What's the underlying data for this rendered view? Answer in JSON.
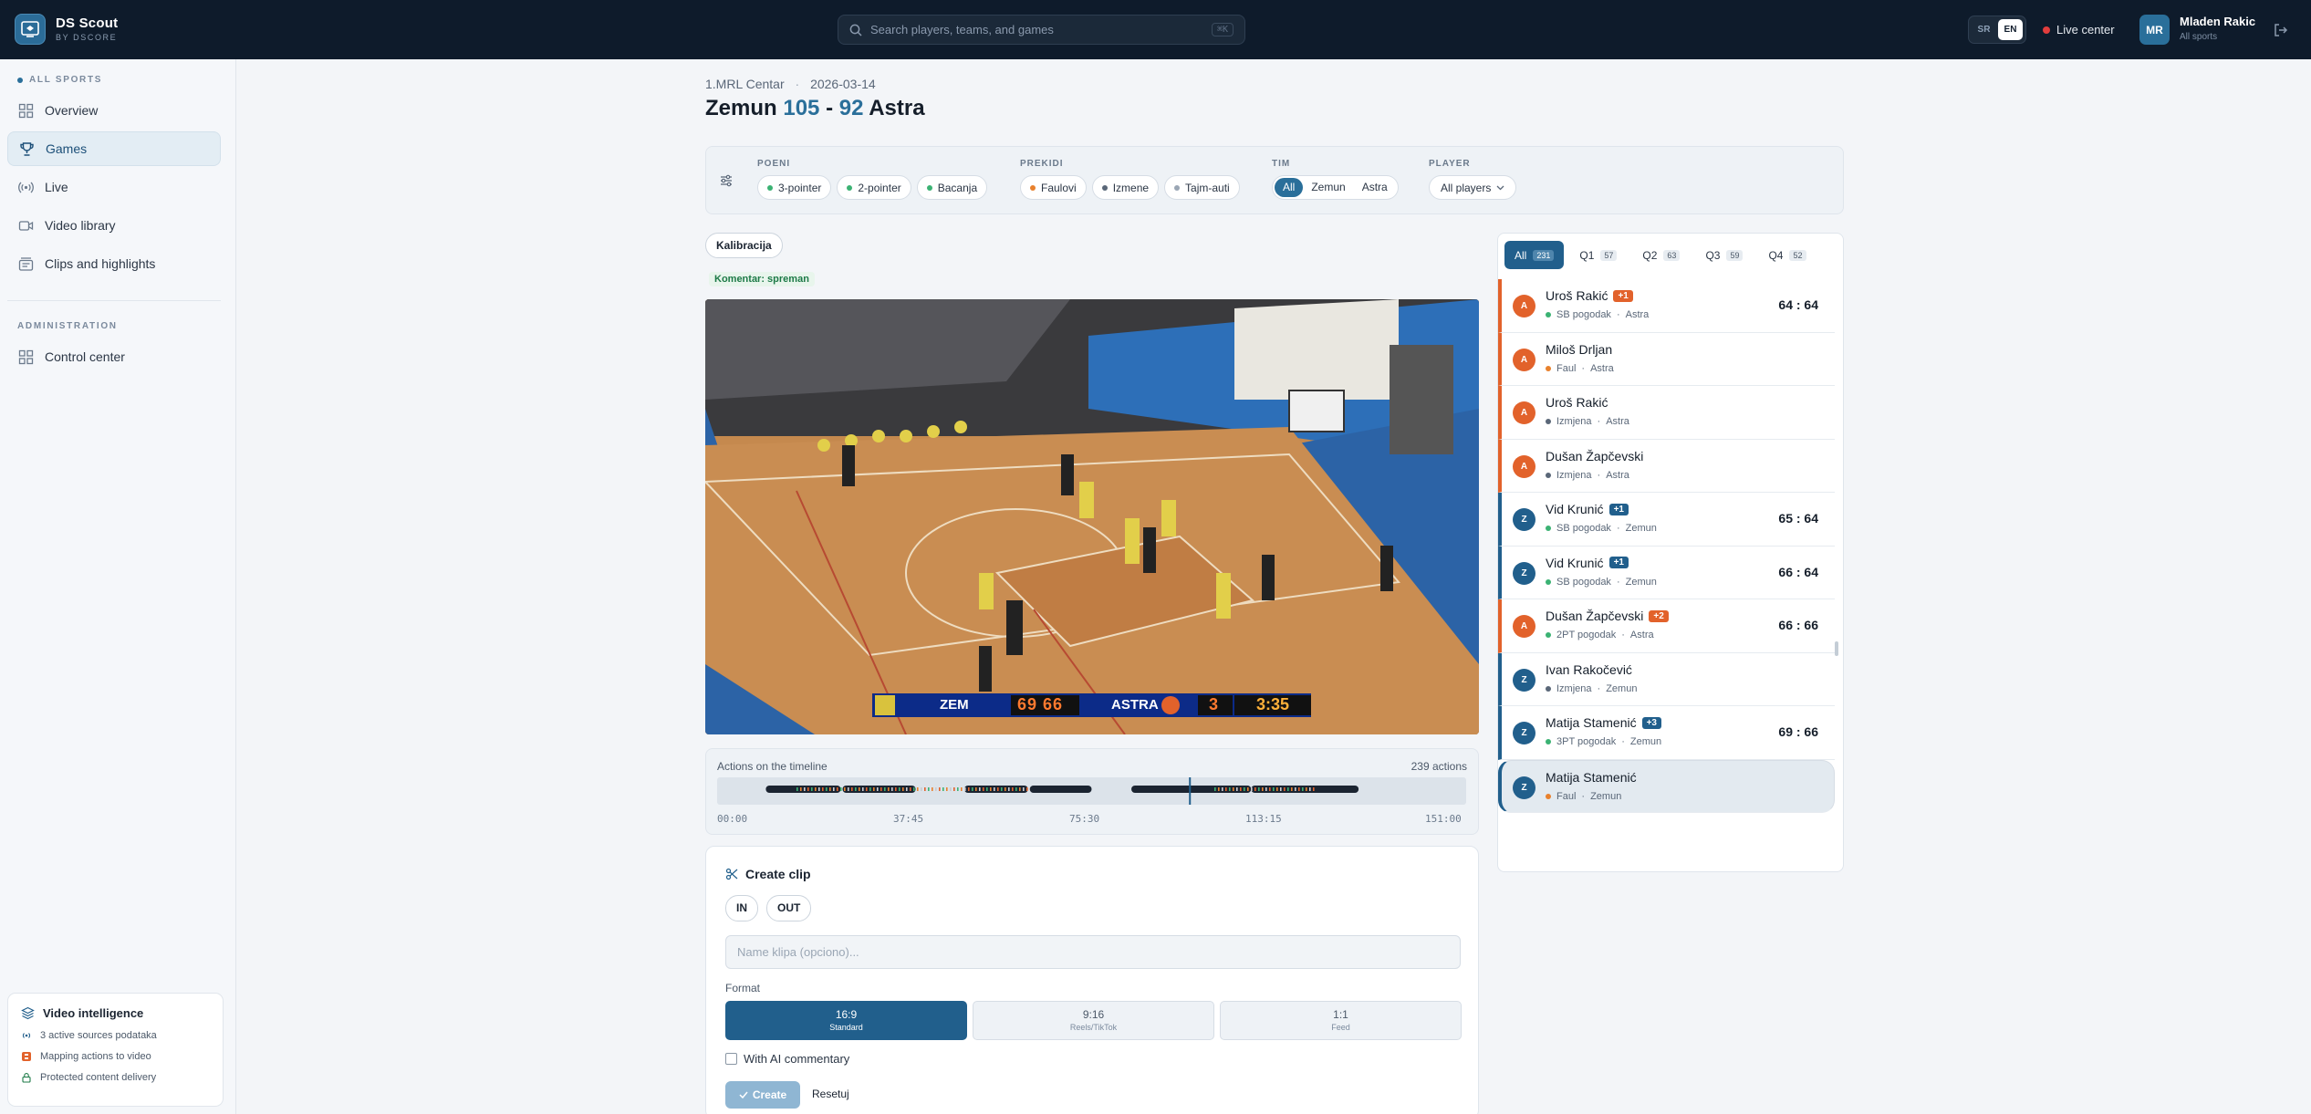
{
  "app": {
    "name": "DS Scout",
    "sub": "BY DSCORE"
  },
  "search": {
    "placeholder": "Search players, teams, and games",
    "shortcut": "⌘K"
  },
  "lang": [
    "SR",
    "EN"
  ],
  "live_center": "Live center",
  "user": {
    "initials": "MR",
    "name": "Mladen Rakic",
    "sub": "All sports"
  },
  "sidebar": {
    "section1": "ALL SPORTS",
    "items": [
      {
        "label": "Overview",
        "icon": "grid-icon"
      },
      {
        "label": "Games",
        "icon": "trophy-icon"
      },
      {
        "label": "Live",
        "icon": "broadcast-icon"
      },
      {
        "label": "Video library",
        "icon": "video-icon"
      },
      {
        "label": "Clips and highlights",
        "icon": "clips-icon"
      }
    ],
    "section2": "ADMINISTRATION",
    "admin_items": [
      {
        "label": "Control center",
        "icon": "grid-icon"
      }
    ],
    "vi": {
      "title": "Video intelligence",
      "rows": [
        "3 active sources podataka",
        "Mapping actions to video",
        "Protected content delivery"
      ]
    }
  },
  "game": {
    "league": "1.MRL Centar",
    "sep": "·",
    "date": "2026-03-14",
    "home": "Zemun",
    "home_score": "105",
    "dash": "-",
    "away_score": "92",
    "away": "Astra"
  },
  "filters": {
    "poeni": {
      "label": "POENI",
      "chips": [
        "3-pointer",
        "2-pointer",
        "Bacanja"
      ]
    },
    "prekidi": {
      "label": "PREKIDI",
      "chips": [
        "Faulovi",
        "Izmene",
        "Tajm-auti"
      ]
    },
    "tim": {
      "label": "TIM",
      "options": [
        "All",
        "Zemun",
        "Astra"
      ]
    },
    "player": {
      "label": "PLAYER",
      "value": "All players"
    }
  },
  "kalibracija": "Kalibracija",
  "komentar": "Komentar: spreman",
  "video": {
    "team1": "ZEM",
    "score": "69 66",
    "team2": "ASTRA",
    "period": "3",
    "clock": "3:35"
  },
  "timeline": {
    "title": "Actions on the timeline",
    "count": "239 actions",
    "ticks": [
      "00:00",
      "37:45",
      "75:30",
      "113:15",
      "151:00"
    ],
    "playhead": 0.63
  },
  "clip": {
    "title": "Create clip",
    "in": "IN",
    "out": "OUT",
    "name_placeholder": "Name klipa (opciono)...",
    "format_label": "Format",
    "formats": [
      {
        "ratio": "16:9",
        "name": "Standard"
      },
      {
        "ratio": "9:16",
        "name": "Reels/TikTok"
      },
      {
        "ratio": "1:1",
        "name": "Feed"
      }
    ],
    "ai": "With AI commentary",
    "create": "Create",
    "reset": "Resetuj"
  },
  "quarters": [
    {
      "label": "All",
      "count": "231"
    },
    {
      "label": "Q1",
      "count": "57"
    },
    {
      "label": "Q2",
      "count": "63"
    },
    {
      "label": "Q3",
      "count": "59"
    },
    {
      "label": "Q4",
      "count": "52"
    }
  ],
  "events": [
    {
      "team": "A",
      "name": "Uroš Rakić",
      "badge": "+1",
      "type": "SB pogodak",
      "team_name": "Astra",
      "score": "64 : 64",
      "dot": "#3bb273"
    },
    {
      "team": "A",
      "name": "Miloš Drljan",
      "badge": "",
      "type": "Faul",
      "team_name": "Astra",
      "score": "",
      "dot": "#e8812d"
    },
    {
      "team": "A",
      "name": "Uroš Rakić",
      "badge": "",
      "type": "Izmjena",
      "team_name": "Astra",
      "score": "",
      "dot": "#5a6778"
    },
    {
      "team": "A",
      "name": "Dušan Žapčevski",
      "badge": "",
      "type": "Izmjena",
      "team_name": "Astra",
      "score": "",
      "dot": "#5a6778"
    },
    {
      "team": "Z",
      "name": "Vid Krunić",
      "badge": "+1",
      "type": "SB pogodak",
      "team_name": "Zemun",
      "score": "65 : 64",
      "dot": "#3bb273"
    },
    {
      "team": "Z",
      "name": "Vid Krunić",
      "badge": "+1",
      "type": "SB pogodak",
      "team_name": "Zemun",
      "score": "66 : 64",
      "dot": "#3bb273"
    },
    {
      "team": "A",
      "name": "Dušan Žapčevski",
      "badge": "+2",
      "type": "2PT pogodak",
      "team_name": "Astra",
      "score": "66 : 66",
      "dot": "#3bb273"
    },
    {
      "team": "Z",
      "name": "Ivan Rakočević",
      "badge": "",
      "type": "Izmjena",
      "team_name": "Zemun",
      "score": "",
      "dot": "#5a6778"
    },
    {
      "team": "Z",
      "name": "Matija Stamenić",
      "badge": "+3",
      "type": "3PT pogodak",
      "team_name": "Zemun",
      "score": "69 : 66",
      "dot": "#3bb273"
    },
    {
      "team": "Z",
      "name": "Matija Stamenić",
      "badge": "",
      "type": "Faul",
      "team_name": "Zemun",
      "score": "",
      "dot": "#e8812d"
    }
  ],
  "colors": {
    "accent": "#215f8c",
    "astra": "#e2622b",
    "topbar": "#0e1b2b"
  }
}
